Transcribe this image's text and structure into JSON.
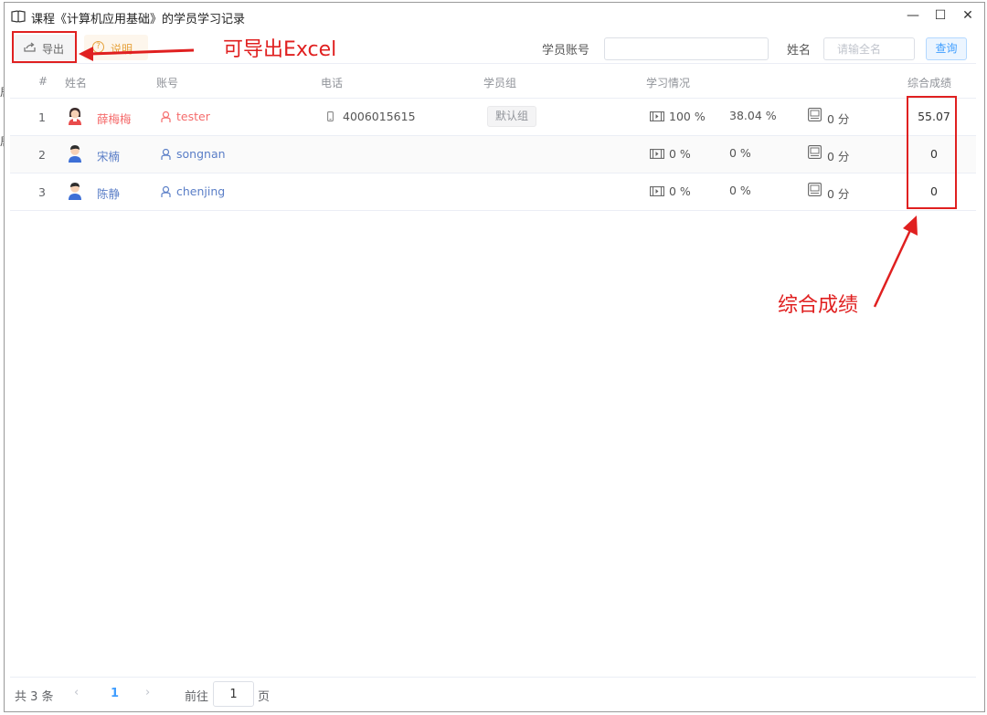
{
  "window": {
    "title": "课程《计算机应用基础》的学员学习记录",
    "controls": {
      "minimize": "—",
      "maximize": "☐",
      "close": "✕"
    }
  },
  "toolbar": {
    "export_label": "导出",
    "help_label": "说明",
    "account_label": "学员账号",
    "account_value": "",
    "name_label": "姓名",
    "name_placeholder": "请输全名",
    "query_label": "查询"
  },
  "table": {
    "headers": {
      "index": "#",
      "name": "姓名",
      "account": "账号",
      "phone": "电话",
      "group": "学员组",
      "study": "学习情况",
      "total": "综合成绩"
    },
    "rows": [
      {
        "index": "1",
        "name": "薛梅梅",
        "account": "tester",
        "phone": "4006015615",
        "group": "默认组",
        "video": "100 %",
        "progress": "38.04 %",
        "exam": "0 分",
        "total": "55.07",
        "gender": "female"
      },
      {
        "index": "2",
        "name": "宋楠",
        "account": "songnan",
        "phone": "",
        "group": "",
        "video": "0 %",
        "progress": "0 %",
        "exam": "0 分",
        "total": "0",
        "gender": "male"
      },
      {
        "index": "3",
        "name": "陈静",
        "account": "chenjing",
        "phone": "",
        "group": "",
        "video": "0 %",
        "progress": "0 %",
        "exam": "0 分",
        "total": "0",
        "gender": "male"
      }
    ]
  },
  "pagination": {
    "total_text": "共 3 条",
    "prev": "‹",
    "current_page": "1",
    "next": "›",
    "goto_label": "前往",
    "goto_value": "1",
    "unit": "页"
  },
  "annotations": {
    "export_note": "可导出Excel",
    "score_note": "综合成绩",
    "color": "#e02020"
  },
  "icons": [
    "book-icon",
    "export-icon",
    "question-icon",
    "female-avatar-icon",
    "male-avatar-icon",
    "user-icon",
    "phone-icon",
    "video-icon",
    "exam-icon"
  ]
}
